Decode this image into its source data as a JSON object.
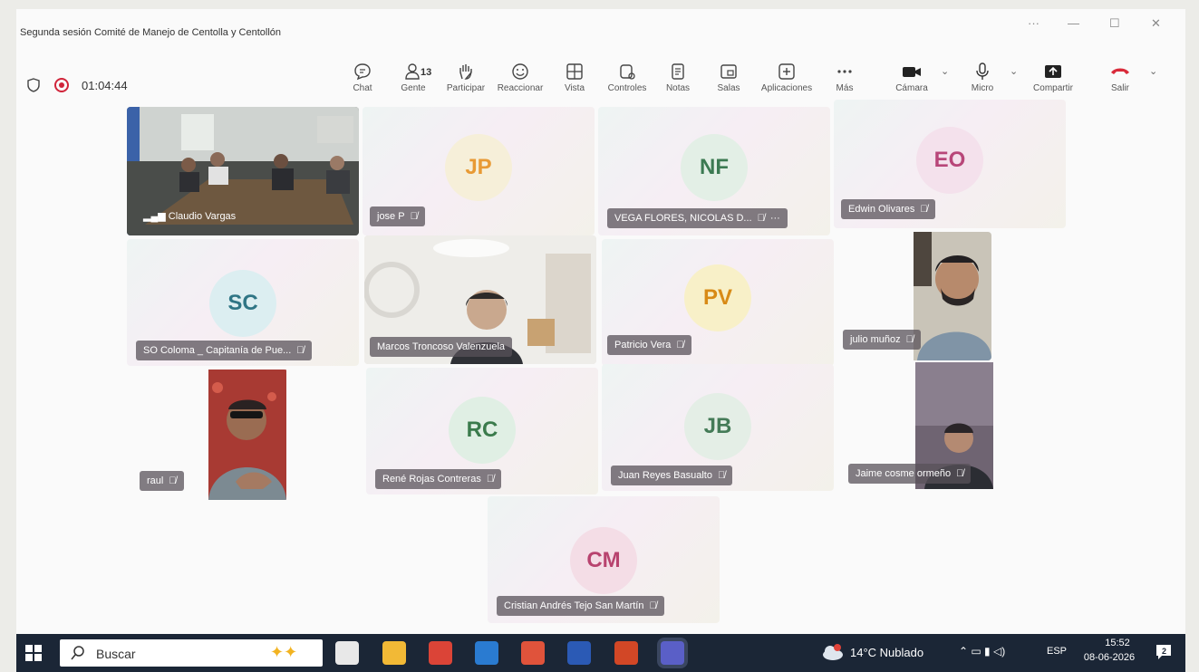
{
  "window": {
    "title": "Segunda sesión Comité de Manejo de Centolla y Centollón",
    "controls": {
      "more": "···",
      "minimize": "—",
      "maximize": "☐",
      "close": "✕"
    }
  },
  "call": {
    "timer": "01:04:44",
    "people_count": "13"
  },
  "toolbar": [
    {
      "key": "chat",
      "label": "Chat",
      "icon": "chat-icon"
    },
    {
      "key": "people",
      "label": "Gente",
      "icon": "people-icon"
    },
    {
      "key": "raise",
      "label": "Participar",
      "icon": "raise-hand-icon"
    },
    {
      "key": "react",
      "label": "Reaccionar",
      "icon": "smiley-icon"
    },
    {
      "key": "view",
      "label": "Vista",
      "icon": "grid-icon"
    },
    {
      "key": "controls",
      "label": "Controles",
      "icon": "controls-icon"
    },
    {
      "key": "notes",
      "label": "Notas",
      "icon": "notes-icon"
    },
    {
      "key": "rooms",
      "label": "Salas",
      "icon": "rooms-icon"
    },
    {
      "key": "apps",
      "label": "Aplicaciones",
      "icon": "plus-box-icon"
    },
    {
      "key": "more",
      "label": "Más",
      "icon": "ellipsis-icon"
    },
    {
      "key": "camera",
      "label": "Cámara",
      "icon": "camera-icon"
    },
    {
      "key": "mic",
      "label": "Micro",
      "icon": "microphone-icon"
    },
    {
      "key": "share",
      "label": "Compartir",
      "icon": "share-icon"
    },
    {
      "key": "leave",
      "label": "Salir",
      "icon": "hangup-icon"
    }
  ],
  "participants": [
    {
      "name": "Claudio Vargas",
      "initials": "",
      "type": "video"
    },
    {
      "name": "jose P",
      "initials": "JP",
      "type": "avatar",
      "color": "#e89a35",
      "bg": "#f6efd9"
    },
    {
      "name": "VEGA FLORES, NICOLAS D...",
      "initials": "NF",
      "type": "avatar",
      "color": "#3c7a52",
      "bg": "#e3efe6"
    },
    {
      "name": "Edwin Olivares",
      "initials": "EO",
      "type": "avatar",
      "color": "#b84679",
      "bg": "#f4e1ec"
    },
    {
      "name": "SO Coloma _ Capitanía de Pue...",
      "initials": "SC",
      "type": "avatar",
      "color": "#2f7585",
      "bg": "#dceef1"
    },
    {
      "name": "Marcos Troncoso Valenzuela",
      "initials": "",
      "type": "video"
    },
    {
      "name": "Patricio Vera",
      "initials": "PV",
      "type": "avatar",
      "color": "#d88a16",
      "bg": "#f8f0c8"
    },
    {
      "name": "julio muñoz",
      "initials": "",
      "type": "video"
    },
    {
      "name": "raul",
      "initials": "",
      "type": "video"
    },
    {
      "name": "René Rojas Contreras",
      "initials": "RC",
      "type": "avatar",
      "color": "#3b7b4c",
      "bg": "#e0efe4"
    },
    {
      "name": "Juan Reyes Basualto",
      "initials": "JB",
      "type": "avatar",
      "color": "#447b57",
      "bg": "#e4eee6"
    },
    {
      "name": "Jaime cosme ormeño",
      "initials": "",
      "type": "video"
    },
    {
      "name": "Cristian Andrés Tejo San Martín",
      "initials": "CM",
      "type": "avatar",
      "color": "#b8436f",
      "bg": "#f4dde6"
    }
  ],
  "taskbar": {
    "search_label": "Buscar",
    "weather": "14°C  Nublado",
    "lang": "ESP",
    "time": "15:52",
    "date": "08-06-2026",
    "notification_count": "2",
    "apps": [
      {
        "name": "task-view-icon",
        "color": "#e8e8e8"
      },
      {
        "name": "file-explorer-icon",
        "color": "#f2b936"
      },
      {
        "name": "chrome-icon",
        "color": "#db4437"
      },
      {
        "name": "outlook-icon",
        "color": "#2a7bd1"
      },
      {
        "name": "chrome-alt-icon",
        "color": "#e0533b"
      },
      {
        "name": "word-icon",
        "color": "#2b5ab5"
      },
      {
        "name": "powerpoint-icon",
        "color": "#d24726"
      },
      {
        "name": "teams-icon",
        "color": "#5a5fc7"
      }
    ]
  }
}
